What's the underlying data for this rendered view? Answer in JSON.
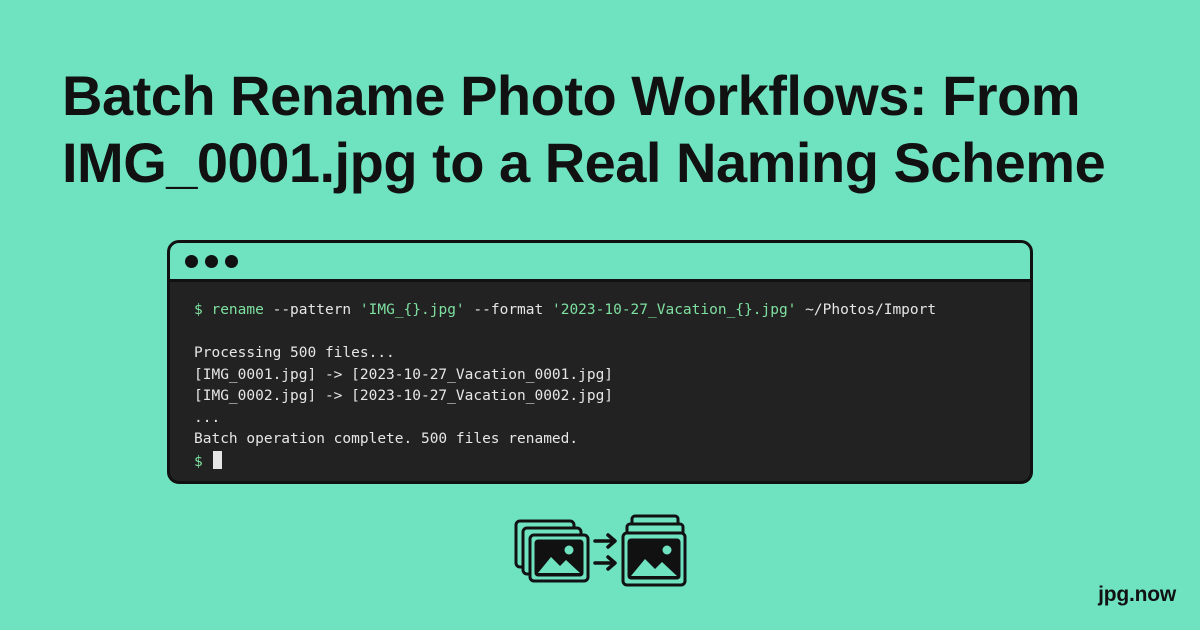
{
  "headline": {
    "line1": "Batch Rename Photo Workflows: From",
    "line2": "IMG_0001.jpg to a Real Naming Scheme"
  },
  "terminal": {
    "prompt": "$",
    "command": {
      "program": "rename",
      "flag_pattern": "--pattern",
      "pattern_value": "'IMG_{}.jpg'",
      "flag_format": "--format",
      "format_value": "'2023-10-27_Vacation_{}.jpg'",
      "path": "~/Photos/Import"
    },
    "output": [
      "Processing 500 files...",
      "[IMG_0001.jpg] -> [2023-10-27_Vacation_0001.jpg]",
      "[IMG_0002.jpg] -> [2023-10-27_Vacation_0002.jpg]",
      "...",
      "Batch operation complete. 500 files renamed."
    ],
    "final_prompt": "$"
  },
  "icons": {
    "source": "photo-stack-icon",
    "arrows": "double-arrow-right-icon",
    "target": "organized-photo-stack-icon"
  },
  "brand": {
    "name": "jpg.now"
  },
  "colors": {
    "background": "#6fe3c0",
    "terminal_bg": "#222222",
    "terminal_text": "#e6e6e6",
    "terminal_accent": "#7ee0a0",
    "ink": "#111111"
  }
}
